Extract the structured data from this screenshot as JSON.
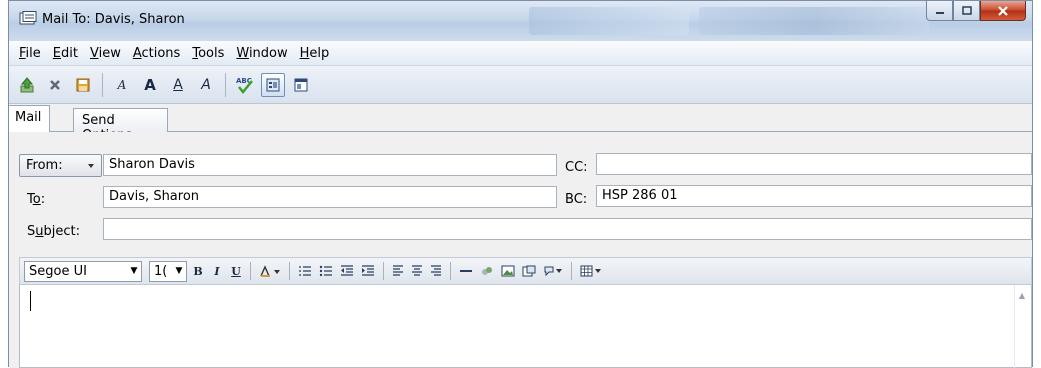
{
  "window": {
    "title": "Mail To: Davis, Sharon"
  },
  "menu": [
    {
      "label": "File",
      "accel": "F",
      "rest": "ile"
    },
    {
      "label": "Edit",
      "accel": "E",
      "rest": "dit"
    },
    {
      "label": "View",
      "accel": "V",
      "rest": "iew"
    },
    {
      "label": "Actions",
      "accel": "A",
      "rest": "ctions"
    },
    {
      "label": "Tools",
      "accel": "T",
      "rest": "ools"
    },
    {
      "label": "Window",
      "accel": "W",
      "rest": "indow"
    },
    {
      "label": "Help",
      "accel": "H",
      "rest": "elp"
    }
  ],
  "toolbar": {
    "font_a_small": "A",
    "font_a_bold": "A",
    "font_a_underline": "A",
    "font_a_italic": "A",
    "spell_label": "ABC"
  },
  "tabs": {
    "mail": "Mail",
    "send_options": "Send Options"
  },
  "form": {
    "from_label": "From:",
    "from_value": "Sharon Davis",
    "to_label_accel": "o",
    "to_label_pre": "T",
    "to_label_post": ":",
    "to_value": "Davis, Sharon",
    "subject_label_pre": "S",
    "subject_label_accel": "u",
    "subject_label_post": "bject:",
    "subject_value": "",
    "cc_label": "CC:",
    "cc_value": "",
    "bc_label": "BC:",
    "bc_value": "HSP 286 01"
  },
  "format": {
    "font_name": "Segoe UI",
    "font_size": "1(",
    "bold": "B",
    "italic": "I",
    "underline": "U"
  },
  "colors": {
    "titlebar": "#c6d7ea",
    "close_button": "#c7472c"
  }
}
